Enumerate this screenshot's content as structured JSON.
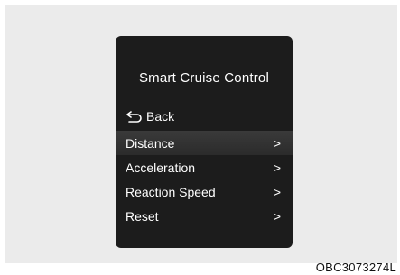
{
  "screen": {
    "title": "Smart Cruise Control",
    "back_label": "Back",
    "menu": [
      {
        "label": "Distance",
        "arrow": ">",
        "selected": true
      },
      {
        "label": "Acceleration",
        "arrow": ">",
        "selected": false
      },
      {
        "label": "Reaction Speed",
        "arrow": ">",
        "selected": false
      },
      {
        "label": "Reset",
        "arrow": ">",
        "selected": false
      }
    ]
  },
  "caption": "OBC3073274L",
  "colors": {
    "background": "#ebebeb",
    "screen": "#1c1c1c",
    "selected_row": "#333333",
    "text": "#ffffff"
  }
}
